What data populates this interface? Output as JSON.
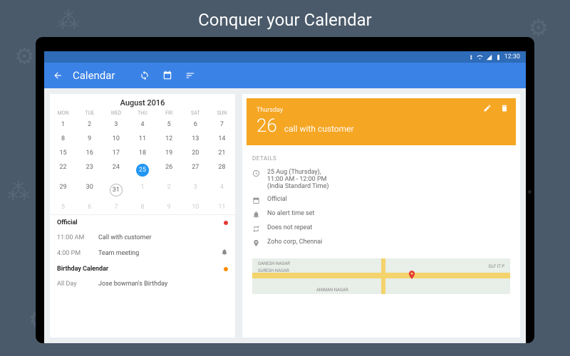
{
  "hero": {
    "title": "Conquer your Calendar"
  },
  "statusbar": {
    "time": "12:30"
  },
  "toolbar": {
    "title": "Calendar"
  },
  "calendar": {
    "month_label": "August 2016",
    "dow": [
      "MON",
      "TUE",
      "WED",
      "THU",
      "FRI",
      "SAT",
      "SUN"
    ],
    "weeks": [
      [
        {
          "n": "1"
        },
        {
          "n": "2"
        },
        {
          "n": "3"
        },
        {
          "n": "4"
        },
        {
          "n": "5"
        },
        {
          "n": "6"
        },
        {
          "n": "7"
        }
      ],
      [
        {
          "n": "8"
        },
        {
          "n": "9"
        },
        {
          "n": "10"
        },
        {
          "n": "11"
        },
        {
          "n": "12"
        },
        {
          "n": "13"
        },
        {
          "n": "14"
        }
      ],
      [
        {
          "n": "15"
        },
        {
          "n": "16"
        },
        {
          "n": "17"
        },
        {
          "n": "18"
        },
        {
          "n": "19"
        },
        {
          "n": "20"
        },
        {
          "n": "21"
        }
      ],
      [
        {
          "n": "22"
        },
        {
          "n": "23"
        },
        {
          "n": "24"
        },
        {
          "n": "25",
          "selected": true
        },
        {
          "n": "26"
        },
        {
          "n": "27"
        },
        {
          "n": "28"
        }
      ],
      [
        {
          "n": "29"
        },
        {
          "n": "30"
        },
        {
          "n": "31",
          "today": true
        },
        {
          "n": "1",
          "other": true
        },
        {
          "n": "2",
          "other": true
        },
        {
          "n": "3",
          "other": true
        },
        {
          "n": "4",
          "other": true
        }
      ],
      [
        {
          "n": "5",
          "other": true
        },
        {
          "n": "6",
          "other": true
        },
        {
          "n": "7",
          "other": true
        },
        {
          "n": "8",
          "other": true
        },
        {
          "n": "9",
          "other": true
        },
        {
          "n": "10",
          "other": true
        },
        {
          "n": "11",
          "other": true
        }
      ]
    ]
  },
  "schedule": {
    "sections": [
      {
        "title": "Official",
        "dot": "red",
        "events": [
          {
            "time": "11:00 AM",
            "title": "Call with customer",
            "bell": false
          },
          {
            "time": "4:00 PM",
            "title": "Team meeting",
            "bell": true
          }
        ]
      },
      {
        "title": "Birthday Calendar",
        "dot": "orange",
        "events": [
          {
            "time": "All Day",
            "title": "Jose bowman's Birthday",
            "bell": false
          }
        ]
      }
    ]
  },
  "event": {
    "weekday": "Thursday",
    "daynum": "26",
    "title": "call with customer"
  },
  "details": {
    "label": "DETAILS",
    "datetime_line1": "25 Aug (Thursday),",
    "datetime_line2": "11:00 AM - 12:00 PM",
    "datetime_line3": "(India Standard Time)",
    "calendar_name": "Official",
    "alert": "No alert time set",
    "repeat": "Does not repeat",
    "location": "Zoho corp, Chennai"
  },
  "map": {
    "labels": [
      "GANESH NAGAR",
      "SURESH NAGAR",
      "DLF IT P",
      "ANIMAN NAGAR"
    ]
  }
}
